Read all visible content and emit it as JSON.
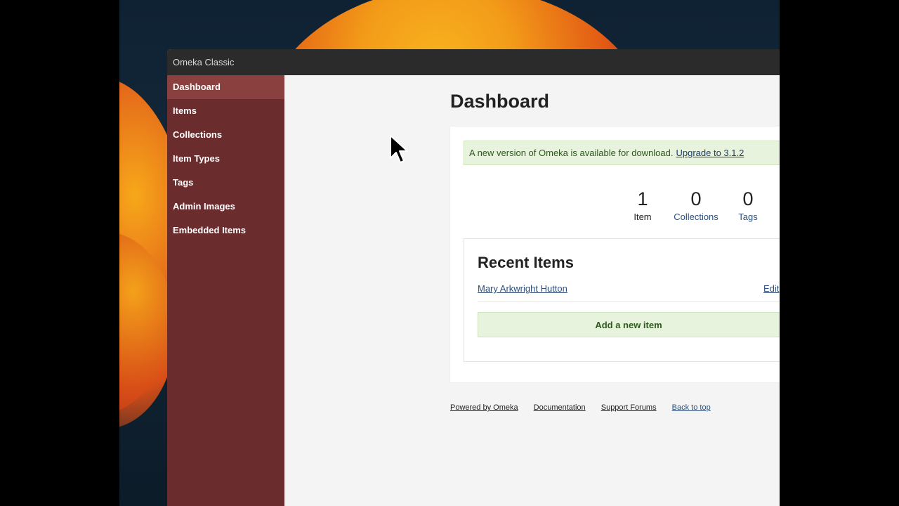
{
  "window": {
    "title": "Omeka Classic"
  },
  "sidebar": {
    "items": [
      {
        "label": "Dashboard",
        "active": true
      },
      {
        "label": "Items"
      },
      {
        "label": "Collections"
      },
      {
        "label": "Item Types"
      },
      {
        "label": "Tags"
      },
      {
        "label": "Admin Images"
      },
      {
        "label": "Embedded Items"
      }
    ]
  },
  "main": {
    "title": "Dashboard",
    "notice": {
      "text": "A new version of Omeka is available for download.",
      "link": "Upgrade to 3.1.2"
    },
    "stats": [
      {
        "value": "1",
        "label": "Item"
      },
      {
        "value": "0",
        "label": "Collections"
      },
      {
        "value": "0",
        "label": "Tags"
      }
    ],
    "recent": {
      "heading": "Recent Items",
      "items": [
        {
          "title": "Mary Arkwright Hutton",
          "edit": "Edit"
        }
      ],
      "add_button": "Add a new item"
    }
  },
  "footer": {
    "links": [
      "Powered by Omeka",
      "Documentation",
      "Support Forums",
      "Back to top"
    ]
  },
  "colors": {
    "sidebar": "#6b2c2e",
    "sidebar_active": "#8a403f",
    "notice_bg": "#e7f3dc",
    "link": "#2e4f7a"
  }
}
